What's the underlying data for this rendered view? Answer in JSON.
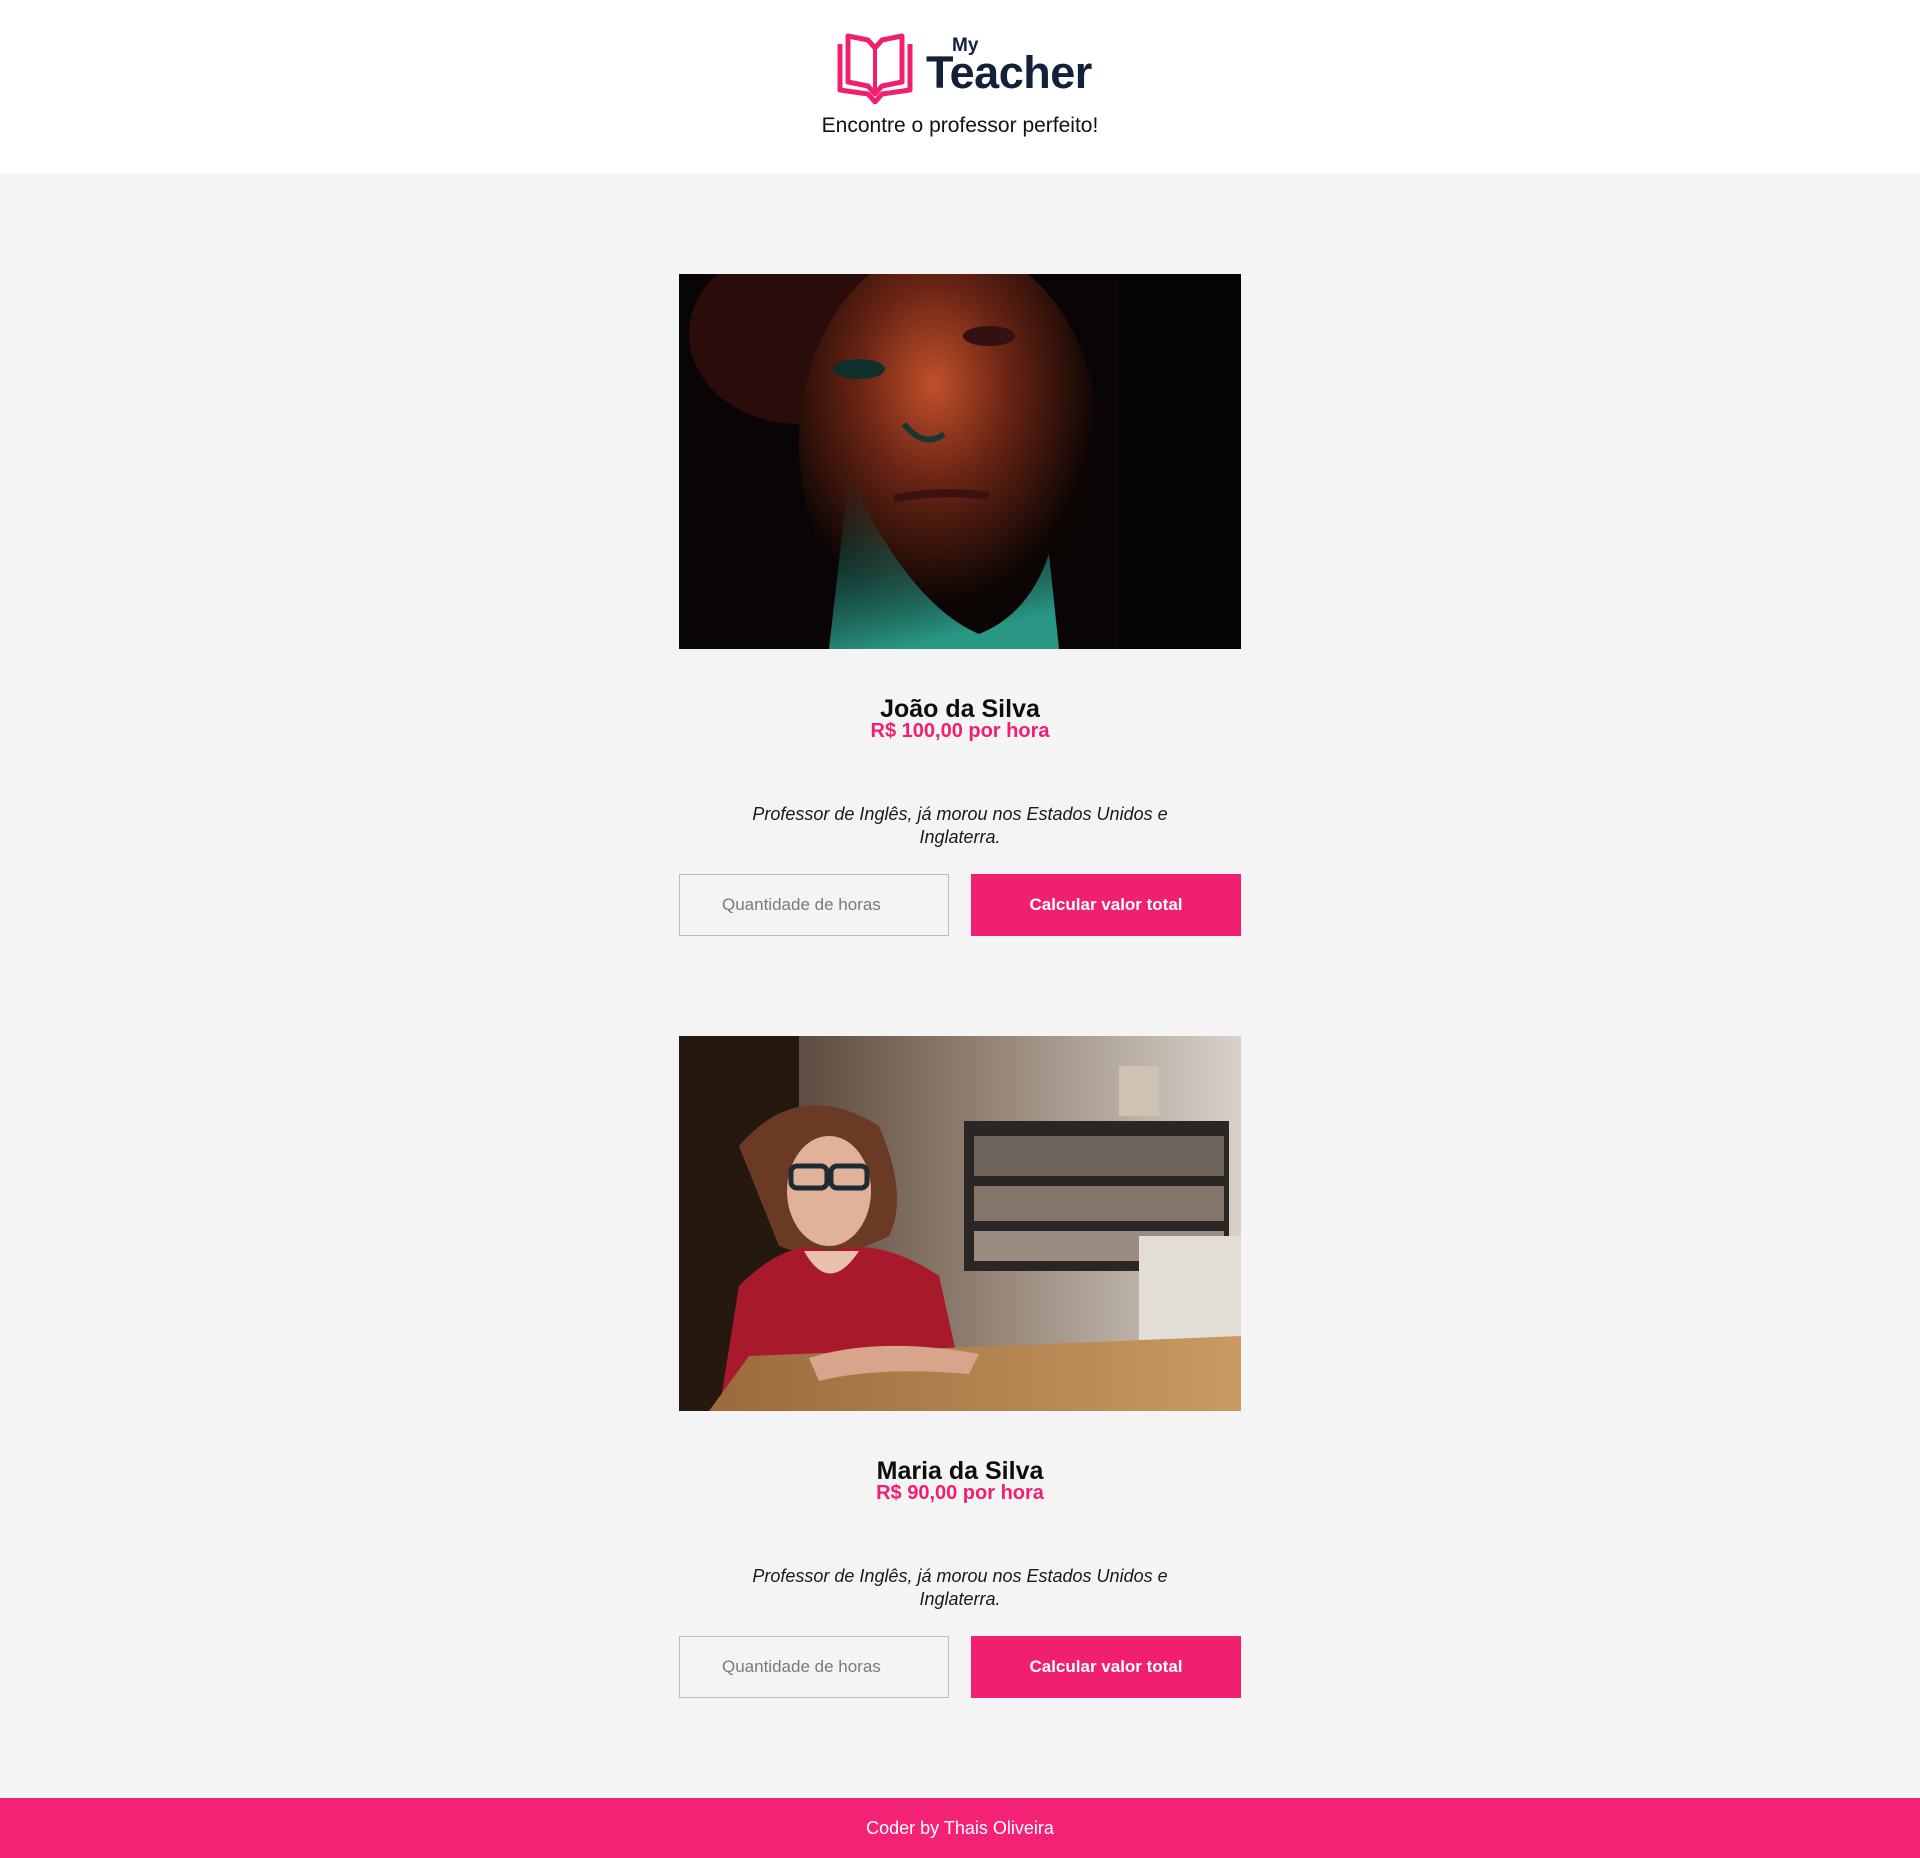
{
  "header": {
    "logo_small": "My",
    "logo_large": "Teacher",
    "tagline": "Encontre o professor perfeito!"
  },
  "teachers": [
    {
      "name": "João da Silva",
      "price": "R$ 100,00 por hora",
      "description": "Professor de Inglês, já morou nos Estados Unidos e Inglaterra.",
      "hours_placeholder": "Quantidade de horas",
      "button_label": "Calcular valor total",
      "photo_icon": "portrait-man-neon-light"
    },
    {
      "name": "Maria da Silva",
      "price": "R$ 90,00 por hora",
      "description": "Professor de Inglês, já morou nos Estados Unidos e Inglaterra.",
      "hours_placeholder": "Quantidade de horas",
      "button_label": "Calcular valor total",
      "photo_icon": "portrait-woman-cafe"
    }
  ],
  "footer": {
    "credit": "Coder by Thais Oliveira"
  },
  "colors": {
    "accent": "#f1206f",
    "footer_bg": "#f42275",
    "brand_dark": "#13203a",
    "page_bg": "#f4f4f4"
  }
}
